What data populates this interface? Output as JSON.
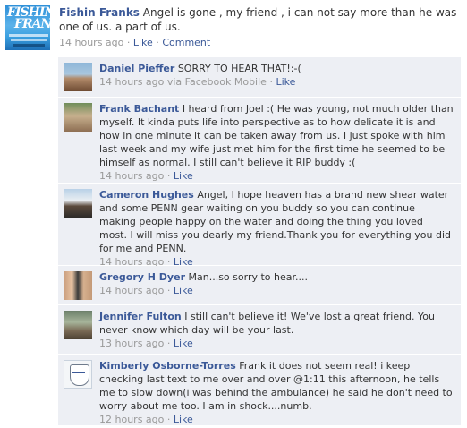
{
  "post": {
    "author": "Fishin Franks",
    "text": "Angel is gone , my friend , i can not say more than he was one of us. a part of us.",
    "time": "14 hours ago",
    "sep": "·",
    "like": "Like",
    "comment": "Comment",
    "avatar_text_line1": "FISHIN",
    "avatar_text_line2": "FRANKS"
  },
  "comments": [
    {
      "author": "Daniel Pieffer",
      "text": "SORRY TO HEAR THAT!:-(",
      "time": "14 hours ago via Facebook Mobile",
      "like": "Like"
    },
    {
      "author": "Frank Bachant",
      "text": "I heard from Joel :( He was young, not much older than myself. It kinda puts life into perspective as to how delicate it is and how in one minute it can be taken away from us. I just spoke with him last week and my wife just met him for the first time he seemed to be himself as normal. I still can't believe it RIP buddy :(",
      "time": "14 hours ago",
      "like": "Like"
    },
    {
      "author": "Cameron Hughes",
      "text": "Angel, I hope heaven has a brand new shear water and some PENN gear waiting on you buddy so you can continue making people happy on the water and doing the thing you loved most. I will miss you dearly my friend.Thank you for everything you did for me and PENN.",
      "time": "14 hours ago",
      "like": "Like"
    },
    {
      "author": "Gregory H Dyer",
      "text": "Man...so sorry to hear....",
      "time": "14 hours ago",
      "like": "Like"
    },
    {
      "author": "Jennifer Fulton",
      "text": "I still can't believe it! We've lost a great friend. You never know which day will be your last.",
      "time": "13 hours ago",
      "like": "Like"
    },
    {
      "author": "Kimberly Osborne-Torres",
      "text": "Frank it does not seem real! i keep checking last text to me over and over @1:11 this afternoon, he tells me to slow down(i was behind the ambulance) he said he don't need to worry about me too. I am in shock....numb.",
      "time": "12 hours ago",
      "like": "Like"
    }
  ],
  "colors": {
    "link": "#3b5998",
    "comment_bg": "#edeff4",
    "meta": "#999999"
  }
}
